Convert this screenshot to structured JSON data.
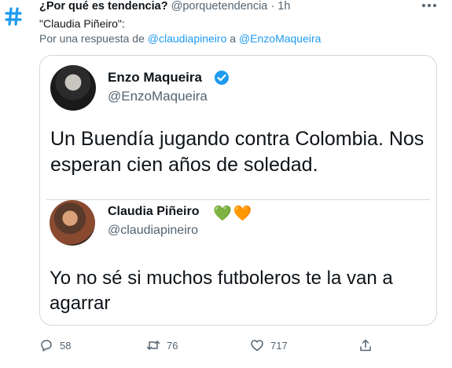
{
  "header": {
    "account_name": "¿Por qué es tendencia?",
    "handle": "@porquetendencia",
    "separator": "·",
    "time": "1h",
    "headline": "\"Claudia Piñeiro\":",
    "reply_prefix": "Por una respuesta de",
    "reply_user": "@claudiapineiro",
    "reply_connector": "a",
    "reply_target": "@EnzoMaqueira"
  },
  "quoted_tweet": {
    "name": "Enzo Maqueira",
    "handle": "@EnzoMaqueira",
    "text": "Un Buendía jugando contra Colombia. Nos esperan cien años de soledad."
  },
  "reply_tweet": {
    "name": "Claudia Piñeiro",
    "hearts": [
      "💚",
      "🧡"
    ],
    "handle": "@claudiapineiro",
    "text": "Yo no sé si muchos futboleros te la van a agarrar"
  },
  "actions": {
    "replies": "58",
    "retweets": "76",
    "likes": "717"
  },
  "colors": {
    "link": "#1d9bf0",
    "secondary": "#536471",
    "border": "#cfd9de"
  }
}
